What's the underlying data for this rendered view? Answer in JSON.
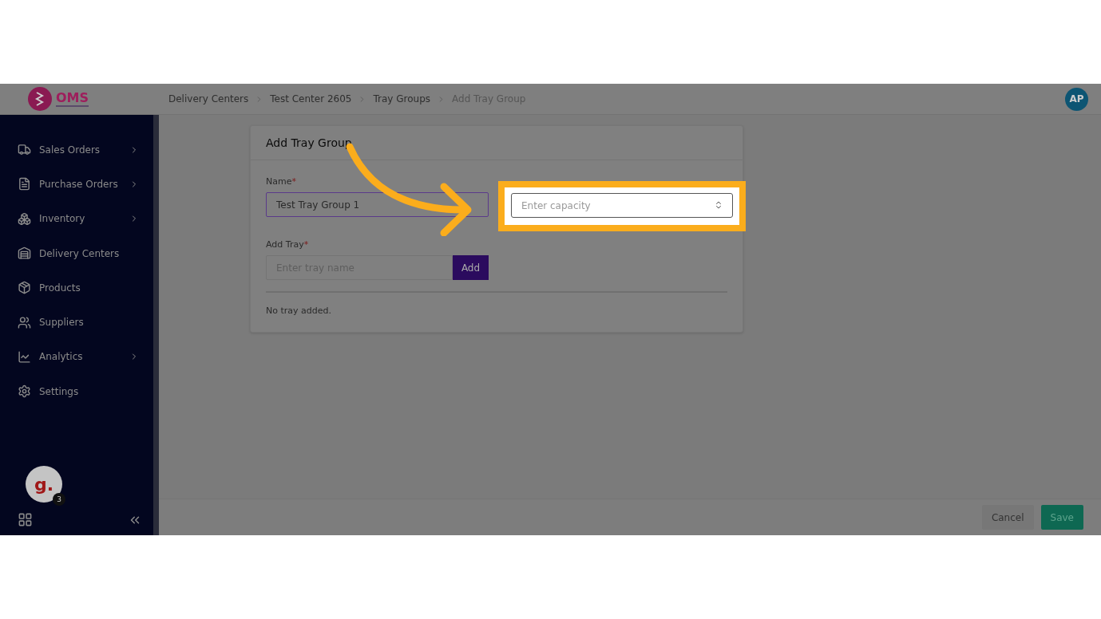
{
  "header": {
    "logo": "OMS",
    "breadcrumbs": [
      {
        "label": "Delivery Centers",
        "current": false
      },
      {
        "label": "Test Center 2605",
        "current": false
      },
      {
        "label": "Tray Groups",
        "current": false
      },
      {
        "label": "Add Tray Group",
        "current": true
      }
    ],
    "avatar": "AP"
  },
  "sidebar": {
    "items": [
      {
        "label": "Sales Orders",
        "expandable": true
      },
      {
        "label": "Purchase Orders",
        "expandable": true
      },
      {
        "label": "Inventory",
        "expandable": true
      },
      {
        "label": "Delivery Centers",
        "expandable": false
      },
      {
        "label": "Products",
        "expandable": false
      },
      {
        "label": "Suppliers",
        "expandable": false
      },
      {
        "label": "Analytics",
        "expandable": true
      },
      {
        "label": "Settings",
        "expandable": false
      }
    ],
    "badge_avatar": "g.",
    "badge_count": "3"
  },
  "form": {
    "title": "Add Tray Group",
    "name_label": "Name",
    "name_value": "Test Tray Group 1",
    "capacity_placeholder": "Enter capacity",
    "tray_label": "Add Tray",
    "tray_placeholder": "Enter tray name",
    "add_button": "Add",
    "empty_text": "No tray added.",
    "required_mark": "*"
  },
  "footer": {
    "buttons": [
      {
        "label": "Cancel",
        "kind": "secondary"
      },
      {
        "label": "Save",
        "kind": "primary"
      }
    ]
  }
}
